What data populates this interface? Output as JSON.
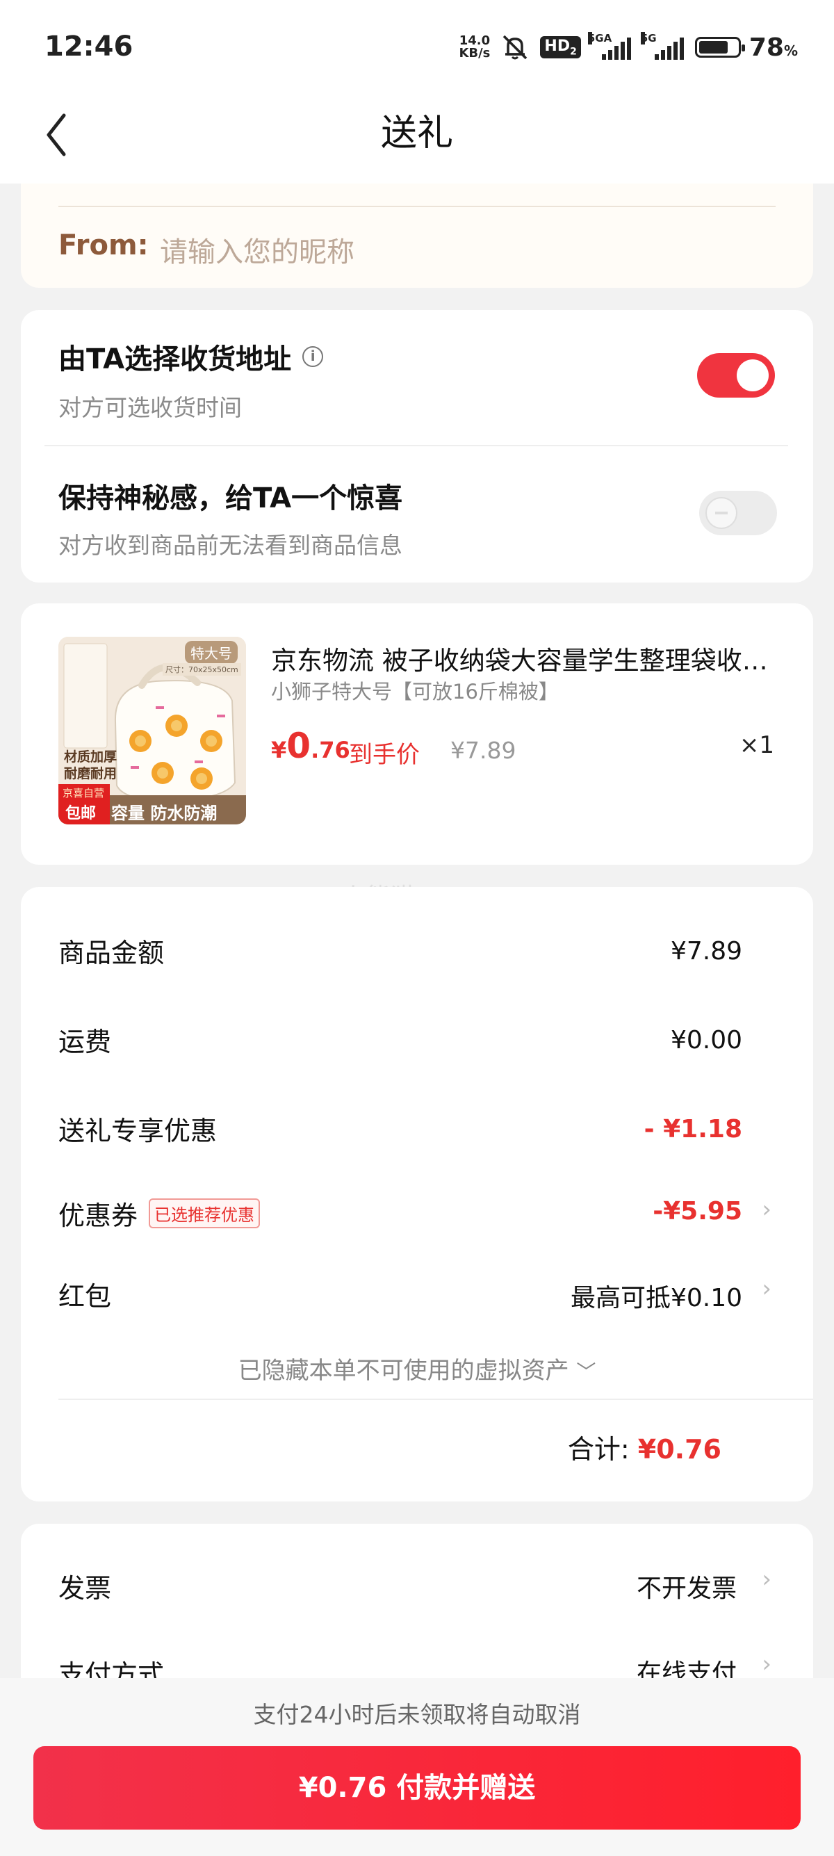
{
  "status_bar": {
    "time": "12:46",
    "net_speed_value": "14.0",
    "net_speed_unit": "KB/s",
    "hd_label": "HD",
    "hd_sub": "2",
    "signal1_label": "5GA",
    "signal2_label": "5G",
    "battery_percent": "78",
    "battery_unit": "%",
    "battery_level": 0.78
  },
  "header": {
    "title": "送礼"
  },
  "from": {
    "label": "From:",
    "placeholder": "请输入您的昵称"
  },
  "options": [
    {
      "title": "由TA选择收货地址",
      "subtitle": "对方可选收货时间",
      "enabled": true
    },
    {
      "title": "保持神秘感，给TA一个惊喜",
      "subtitle": "对方收到商品前无法看到商品信息",
      "enabled": false
    }
  ],
  "product": {
    "name": "京东物流 被子收纳袋大容量学生整理袋收纳袋",
    "spec": "小狮子特大号【可放16斤棉被】",
    "price_symbol": "¥",
    "price_int": "0",
    "price_dec": ".76",
    "price_tag": "到手价",
    "original_price": "¥7.89",
    "quantity": "×1",
    "thumb": {
      "size_tag": "特大号",
      "dims": "尺寸：70x25x50cm",
      "label1": "材质加厚",
      "label2": "耐磨耐用",
      "badge_top": "京喜自营",
      "badge_bottom": "包邮",
      "footer": "容量 防水防潮"
    }
  },
  "fees": {
    "goods_amount": {
      "label": "商品金额",
      "value": "¥7.89"
    },
    "shipping": {
      "label": "运费",
      "value": "¥0.00"
    },
    "gift_discount": {
      "label": "送礼专享优惠",
      "value": "- ¥1.18"
    },
    "coupon": {
      "label": "优惠券",
      "badge": "已选推荐优惠",
      "value": "-¥5.95"
    },
    "red_packet": {
      "label": "红包",
      "value": "最高可抵¥0.10"
    },
    "hidden_assets": "已隐藏本单不可使用的虚拟资产",
    "total_label": "合计:",
    "total_value": "¥0.76"
  },
  "watermark": "小熊猫c",
  "payment": {
    "invoice": {
      "label": "发票",
      "value": "不开发票"
    },
    "method": {
      "label": "支付方式",
      "value": "在线支付"
    }
  },
  "bottom": {
    "notice": "支付24小时后未领取将自动取消",
    "button_label": "¥0.76 付款并赠送"
  },
  "colors": {
    "accent": "#e8312f",
    "button": "#f2314a",
    "from_label": "#8d5a3b"
  }
}
